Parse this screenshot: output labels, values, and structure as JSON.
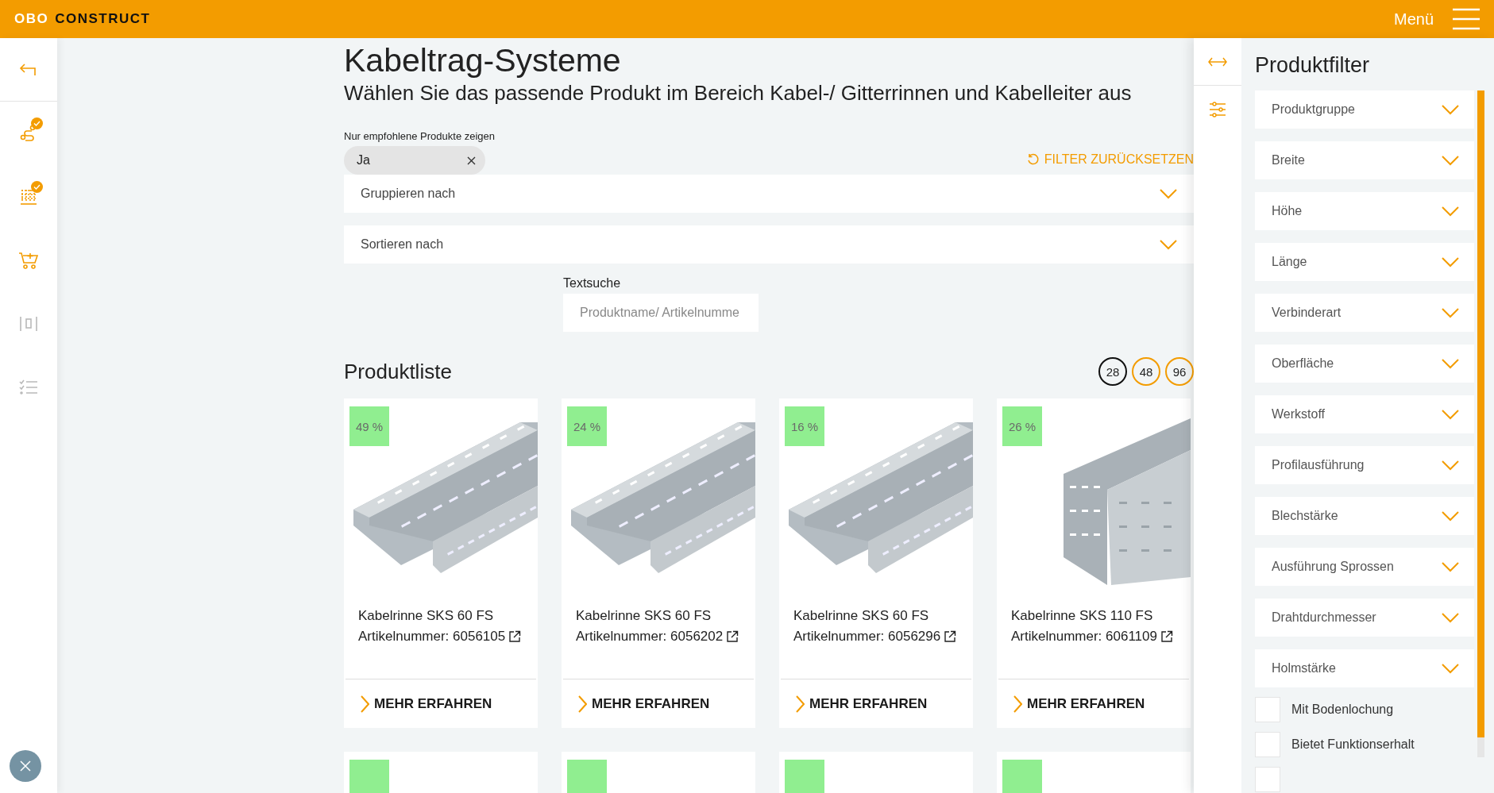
{
  "header": {
    "logo_light": "OBO",
    "logo_dark": "CONSTRUCT",
    "menu_label": "Menü"
  },
  "sidebar": {
    "items": [
      {
        "kind": "back",
        "disabled": false,
        "done": false
      },
      {
        "kind": "route",
        "disabled": false,
        "done": true
      },
      {
        "kind": "grid",
        "disabled": false,
        "done": true
      },
      {
        "kind": "cart",
        "disabled": false,
        "done": false
      },
      {
        "kind": "compare",
        "disabled": true,
        "done": false
      },
      {
        "kind": "checklist",
        "disabled": true,
        "done": false
      }
    ]
  },
  "page": {
    "title": "Kabeltrag-Systeme",
    "subtitle": "Wählen Sie das passende Produkt im Bereich Kabel-/ Gitterrinnen und Kabelleiter aus"
  },
  "recommended": {
    "label": "Nur empfohlene Produkte zeigen",
    "value": "Ja"
  },
  "reset_filter": "FILTER ZURÜCKSETZEN",
  "dropdowns": [
    {
      "label": "Gruppieren nach",
      "expanded": false
    },
    {
      "label": "Sortieren nach",
      "expanded": false
    }
  ],
  "text_search": {
    "label": "Textsuche",
    "placeholder": "Produktname/ Artikelnumme"
  },
  "product_list": {
    "title": "Produktliste",
    "page_sizes": [
      {
        "label": "28",
        "selected": true
      },
      {
        "label": "48",
        "selected": false
      },
      {
        "label": "96",
        "selected": false
      }
    ]
  },
  "products": [
    {
      "kind": "tray",
      "discount": "49 %",
      "name": "Kabelrinne SKS 60 FS",
      "article": "Artikelnummer: 6056105",
      "action": "MEHR ERFAHREN"
    },
    {
      "kind": "tray",
      "discount": "24 %",
      "name": "Kabelrinne SKS 60 FS",
      "article": "Artikelnummer: 6056202",
      "action": "MEHR ERFAHREN"
    },
    {
      "kind": "tray",
      "discount": "16 %",
      "name": "Kabelrinne SKS 60 FS",
      "article": "Artikelnummer: 6056296",
      "action": "MEHR ERFAHREN"
    },
    {
      "kind": "tall",
      "discount": "26 %",
      "name": "Kabelrinne SKS 110 FS",
      "article": "Artikelnummer: 6061109",
      "action": "MEHR ERFAHREN"
    }
  ],
  "next_row": [
    {
      "kind": "card"
    },
    {
      "kind": "card"
    },
    {
      "kind": "card"
    },
    {
      "kind": "card"
    }
  ],
  "filter_panel": {
    "title": "Produktfilter",
    "filters": [
      {
        "label": "Produktgruppe",
        "expanded": false
      },
      {
        "label": "Breite",
        "expanded": false
      },
      {
        "label": "Höhe",
        "expanded": false
      },
      {
        "label": "Länge",
        "expanded": false
      },
      {
        "label": "Verbinderart",
        "expanded": false
      },
      {
        "label": "Oberfläche",
        "expanded": false
      },
      {
        "label": "Werkstoff",
        "expanded": false
      },
      {
        "label": "Profilausführung",
        "expanded": false
      },
      {
        "label": "Blechstärke",
        "expanded": false
      },
      {
        "label": "Ausführung Sprossen",
        "expanded": false
      },
      {
        "label": "Drahtdurchmesser",
        "expanded": false
      },
      {
        "label": "Holmstärke",
        "expanded": false
      }
    ],
    "checkboxes": [
      {
        "label": "Mit Bodenlochung",
        "checked": false
      },
      {
        "label": "Bietet Funktionserhalt",
        "checked": false
      },
      {
        "checked": false
      }
    ]
  }
}
